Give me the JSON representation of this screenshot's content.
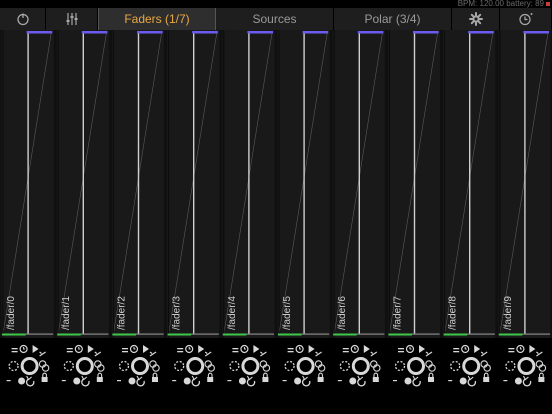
{
  "status": {
    "text": "BPM: 120.00 battery: 89"
  },
  "tabs": [
    {
      "type": "icon",
      "icon": "power-icon",
      "name": "tab-power"
    },
    {
      "type": "icon",
      "icon": "sliders-icon",
      "name": "tab-mixer"
    },
    {
      "type": "text",
      "label": "Faders (1/7)",
      "active": true,
      "name": "tab-faders"
    },
    {
      "type": "text",
      "label": "Sources",
      "name": "tab-sources"
    },
    {
      "type": "text",
      "label": "Polar (3/4)",
      "name": "tab-polar"
    },
    {
      "type": "icon",
      "icon": "gear-icon",
      "name": "tab-settings"
    },
    {
      "type": "icon",
      "icon": "clock-icon",
      "name": "tab-timer"
    }
  ],
  "faders": [
    {
      "label": "/fader/0",
      "value": 1.0
    },
    {
      "label": "/fader/1",
      "value": 1.0
    },
    {
      "label": "/fader/2",
      "value": 1.0
    },
    {
      "label": "/fader/3",
      "value": 1.0
    },
    {
      "label": "/fader/4",
      "value": 1.0
    },
    {
      "label": "/fader/5",
      "value": 1.0
    },
    {
      "label": "/fader/6",
      "value": 1.0
    },
    {
      "label": "/fader/7",
      "value": 1.0
    },
    {
      "label": "/fader/8",
      "value": 1.0
    },
    {
      "label": "/fader/9",
      "value": 1.0
    }
  ],
  "colors": {
    "top_accent": "#6a5cf0",
    "bottom_accent": "#3ec84a",
    "active_tab_text": "#e8a845",
    "fader_line": "#cfcfcf",
    "knob": "#d8d8d8"
  }
}
